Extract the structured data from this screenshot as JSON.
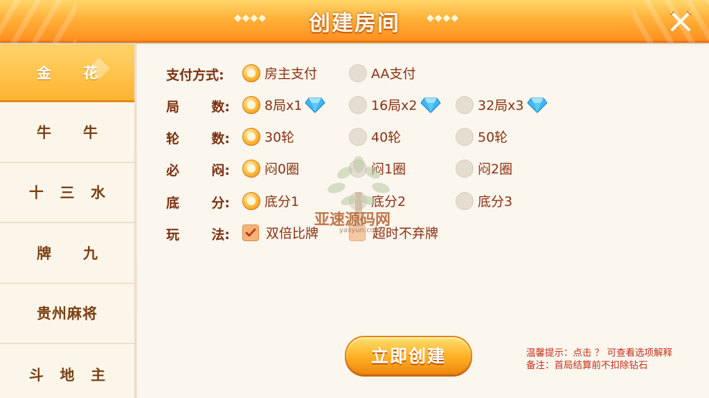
{
  "header": {
    "title": "创建房间",
    "deco_left": "◆◆◆◆",
    "deco_right": "◆◆◆◆",
    "close_icon": "close-icon"
  },
  "sidebar": {
    "items": [
      {
        "chars": [
          "金",
          "花"
        ],
        "active": true
      },
      {
        "chars": [
          "牛",
          "牛"
        ],
        "active": false
      },
      {
        "chars": [
          "十",
          "三",
          "水"
        ],
        "active": false
      },
      {
        "chars": [
          "牌",
          "九"
        ],
        "active": false
      },
      {
        "label": "贵州麻将",
        "active": false
      },
      {
        "chars": [
          "斗",
          "地",
          "主"
        ],
        "active": false
      }
    ]
  },
  "rows": {
    "payment": {
      "label": "支付方式:",
      "options": [
        {
          "label": "房主支付",
          "selected": true
        },
        {
          "label": "AA支付",
          "selected": false
        }
      ]
    },
    "rounds": {
      "label_chars": [
        "局",
        "数:"
      ],
      "options": [
        {
          "label": "8局x1",
          "selected": true,
          "gem": true
        },
        {
          "label": "16局x2",
          "selected": false,
          "gem": true
        },
        {
          "label": "32局x3",
          "selected": false,
          "gem": true
        }
      ]
    },
    "turns": {
      "label_chars": [
        "轮",
        "数:"
      ],
      "options": [
        {
          "label": "30轮",
          "selected": true
        },
        {
          "label": "40轮",
          "selected": false
        },
        {
          "label": "50轮",
          "selected": false
        }
      ]
    },
    "must_blind": {
      "label_chars": [
        "必",
        "闷:"
      ],
      "options": [
        {
          "label": "闷0圈",
          "selected": true
        },
        {
          "label": "闷1圈",
          "selected": false
        },
        {
          "label": "闷2圈",
          "selected": false
        }
      ]
    },
    "base_score": {
      "label_chars": [
        "底",
        "分:"
      ],
      "options": [
        {
          "label": "底分1",
          "selected": true
        },
        {
          "label": "底分2",
          "selected": false
        },
        {
          "label": "底分3",
          "selected": false
        }
      ]
    },
    "play_mode": {
      "label_chars": [
        "玩",
        "法:"
      ],
      "options": [
        {
          "label": "双倍比牌",
          "checked": true
        },
        {
          "label": "超时不弃牌",
          "checked": false
        }
      ]
    }
  },
  "watermark": {
    "text": "亚速源码网",
    "sub": "yasyun.com"
  },
  "create_button": {
    "label": "立即创建"
  },
  "tips": {
    "line1": "温馨提示：点击 ？  可查看选项解释",
    "line2": "备注：首局结算前不扣除钻石"
  },
  "colors": {
    "accent": "#ffb531",
    "label_text": "#7a2f10",
    "option_text": "#8a3010",
    "tip_text": "#c62f1a"
  }
}
